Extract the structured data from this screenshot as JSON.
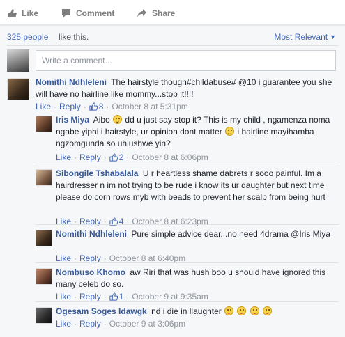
{
  "actions": {
    "like": "Like",
    "comment": "Comment",
    "share": "Share"
  },
  "likes": {
    "count": "325 people",
    "text": "like this."
  },
  "sort": {
    "label": "Most Relevant"
  },
  "composer": {
    "placeholder": "Write a comment..."
  },
  "comments": [
    {
      "author": "Nomithi Ndhleleni",
      "text": "The hairstyle though#childabuse# @10 i guarantee you she will have no hairline like mommy...stop it!!!!",
      "like": "Like",
      "reply": "Reply",
      "reactions": "8",
      "time": "October 8 at 5:31pm"
    },
    {
      "author": "Iris Miya",
      "text_a": "Aibo",
      "text_b": "dd u just say stop it? This is my child , ngamenza noma ngabe yiphi i hairstyle, ur opinion dont matter",
      "text_c": "i hairline mayihamba ngzomgunda so uhlushwe yin?",
      "like": "Like",
      "reply": "Reply",
      "reactions": "2",
      "time": "October 8 at 6:06pm"
    },
    {
      "author": "Sibongile Tshabalala",
      "text": "U r heartless shame dabrets r sooo painful. Im a hairdresser n im not trying to be rude i know its ur daughter but next time please do corn rows myb with beads to prevent her scalp from being hurt",
      "like": "Like",
      "reply": "Reply",
      "reactions": "4",
      "time": "October 8 at 6:23pm"
    },
    {
      "author": "Nomithi Ndhleleni",
      "text": "Pure simple advice dear...no need 4drama @Iris Miya",
      "like": "Like",
      "reply": "Reply",
      "time": "October 8 at 6:40pm"
    },
    {
      "author": "Nombuso Khomo",
      "text": "aw Riri that was hush boo u should have ignored this many celeb do so.",
      "like": "Like",
      "reply": "Reply",
      "reactions": "1",
      "time": "October 9 at 9:35am"
    },
    {
      "author": "Ogesam Soges Idawgk",
      "text": "nd i die in llaughter",
      "like": "Like",
      "reply": "Reply",
      "time": "October 9 at 3:06pm"
    }
  ],
  "colors": {
    "link": "#365899",
    "action_link": "#4267b2",
    "meta": "#90949c",
    "panel_bg": "#f6f7f9"
  },
  "icons": [
    "thumbs-up-icon",
    "comment-bubble-icon",
    "share-arrow-icon",
    "caret-down-icon",
    "shocked-emoji-icon",
    "sad-emoji-icon",
    "laughing-emoji-icon"
  ]
}
